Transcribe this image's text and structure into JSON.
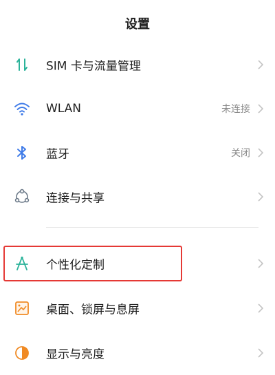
{
  "header": {
    "title": "设置"
  },
  "items": [
    {
      "label": "SIM 卡与流量管理",
      "status": "",
      "icon": "sim-traffic-icon"
    },
    {
      "label": "WLAN",
      "status": "未连接",
      "icon": "wifi-icon"
    },
    {
      "label": "蓝牙",
      "status": "关闭",
      "icon": "bluetooth-icon"
    },
    {
      "label": "连接与共享",
      "status": "",
      "icon": "share-icon"
    },
    {
      "label": "个性化定制",
      "status": "",
      "icon": "personalize-icon"
    },
    {
      "label": "桌面、锁屏与息屏",
      "status": "",
      "icon": "desktop-lock-icon"
    },
    {
      "label": "显示与亮度",
      "status": "",
      "icon": "brightness-icon"
    }
  ],
  "colors": {
    "highlight": "#e53935",
    "teal": "#2bb39a",
    "blue": "#3f7be8",
    "orange": "#f08a24",
    "gray_icon": "#6c7a89",
    "chevron": "#c4c4c4"
  }
}
